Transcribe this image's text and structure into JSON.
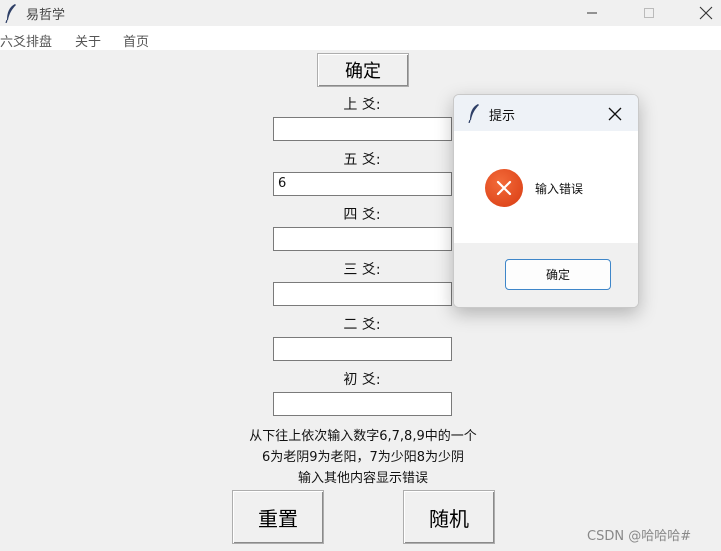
{
  "window": {
    "title": "易哲学",
    "icon": "feather-icon",
    "controls": [
      "minimize-icon",
      "maximize-icon",
      "close-icon"
    ]
  },
  "menu": [
    "六爻排盘",
    "关于",
    "首页"
  ],
  "main": {
    "confirm_label": "确定",
    "fields": [
      {
        "label": "上 爻:",
        "value": ""
      },
      {
        "label": "五 爻:",
        "value": "6"
      },
      {
        "label": "四 爻:",
        "value": ""
      },
      {
        "label": "三 爻:",
        "value": ""
      },
      {
        "label": "二 爻:",
        "value": ""
      },
      {
        "label": "初 爻:",
        "value": ""
      }
    ],
    "instructions": [
      "从下往上依次输入数字6,7,8,9中的一个",
      "6为老阴9为老阳，7为少阳8为少阴",
      "输入其他内容显示错误"
    ],
    "reset_label": "重置",
    "random_label": "随机"
  },
  "dialog": {
    "title": "提示",
    "icon": "error-icon",
    "message": "输入错误",
    "ok_label": "确定"
  },
  "watermark": "CSDN @哈哈哈#"
}
